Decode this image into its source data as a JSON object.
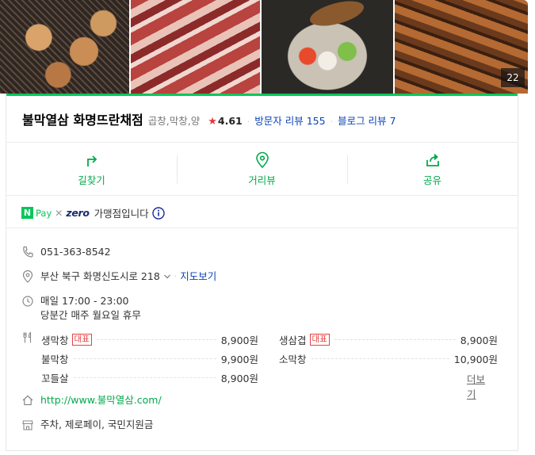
{
  "photos": {
    "count": "22",
    "items": [
      "grilled-gopchang-photo",
      "pork-belly-photo",
      "gopchang-hotpot-photo",
      "grilled-makchang-photo"
    ]
  },
  "business": {
    "name": "불막열삼 화명뜨란채점",
    "category": "곱창,막창,양",
    "rating_star": "★",
    "rating": "4.61",
    "visitor_review_label": "방문자 리뷰",
    "visitor_review_count": "155",
    "blog_review_label": "블로그 리뷰",
    "blog_review_count": "7"
  },
  "actions": {
    "directions": "길찾기",
    "street_view": "거리뷰",
    "share": "공유"
  },
  "payment": {
    "npay_letter": "N",
    "npay_text": "Pay",
    "times": "✕",
    "zero_text": "zero",
    "description": "가맹점입니다"
  },
  "info": {
    "phone": "051-363-8542",
    "address": "부산 북구 화명신도시로 218",
    "map_link": "지도보기",
    "hours_line1": "매일 17:00 - 23:00",
    "hours_line2": "당분간 매주 월요일 휴무",
    "website": "http://www.불막열삼.com/",
    "facilities": "주차, 제로페이, 국민지원금"
  },
  "menu": {
    "badge_label": "대표",
    "items": [
      {
        "name": "생막창",
        "price": "8,900원"
      },
      {
        "name": "생삼겹",
        "price": "8,900원"
      },
      {
        "name": "불막창",
        "price": "9,900원"
      },
      {
        "name": "소막창",
        "price": "10,900원"
      },
      {
        "name": "꼬들살",
        "price": "8,900원"
      }
    ],
    "more_label": "더보기"
  },
  "colors": {
    "brand_green": "#03c75a",
    "link_blue": "#0c43b7",
    "badge_red": "#e54343",
    "star_red": "#e23a3a"
  }
}
